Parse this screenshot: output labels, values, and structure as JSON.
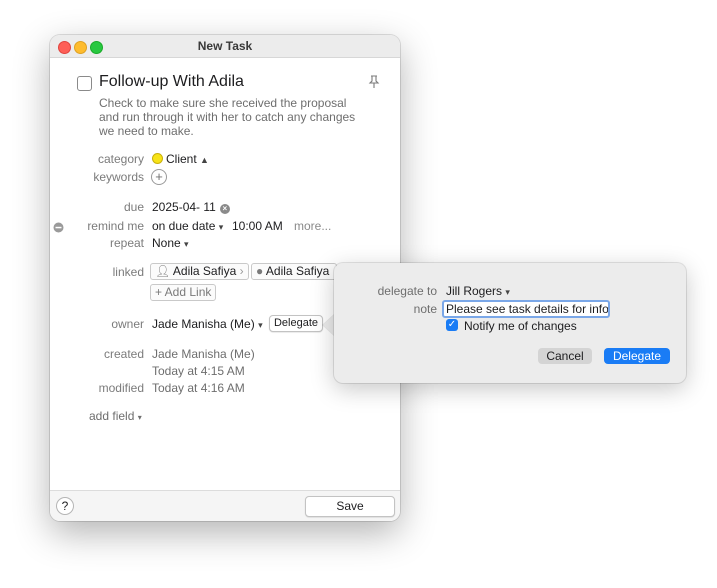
{
  "window": {
    "title": "New Task"
  },
  "task": {
    "title": "Follow-up With Adila",
    "description": "Check to make sure she received the proposal and run through it with her to catch any changes we need to make."
  },
  "fields": {
    "category_label": "category",
    "category_value": "Client",
    "category_color": "#f7e317",
    "keywords_label": "keywords",
    "due_label": "due",
    "due_value": "2025-04- 11",
    "remind_label": "remind me",
    "remind_value": "on due date",
    "remind_time": "10:00 AM",
    "remind_more": "more...",
    "repeat_label": "repeat",
    "repeat_value": "None",
    "linked_label": "linked",
    "linked_1": "Adila Safiya",
    "linked_2": "Adila Safiya",
    "add_link": "+ Add Link",
    "owner_label": "owner",
    "owner_value": "Jade Manisha (Me)",
    "delegate_button": "Delegate",
    "created_label": "created",
    "created_by": "Jade Manisha (Me)",
    "created_time": "Today at 4:15 AM",
    "modified_label": "modified",
    "modified_time": "Today at 4:16 AM",
    "add_field": "add field"
  },
  "bottom": {
    "help": "?",
    "save": "Save"
  },
  "popover": {
    "delegate_to_label": "delegate to",
    "delegate_to_value": "Jill Rogers",
    "note_label": "note",
    "note_value": "Please see task details for info.",
    "notify_label": "Notify me of changes",
    "notify_checked": true,
    "cancel": "Cancel",
    "delegate": "Delegate",
    "accent_color": "#1a7cf5"
  }
}
